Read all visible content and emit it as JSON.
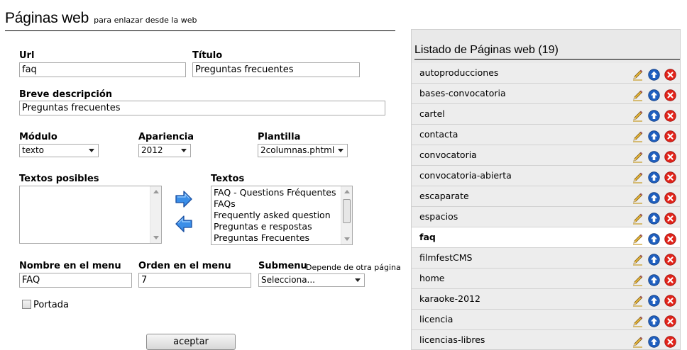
{
  "header": {
    "title": "Páginas web",
    "subtitle": "para enlazar desde la web"
  },
  "form": {
    "url": {
      "label": "Url",
      "value": "faq"
    },
    "titulo": {
      "label": "Título",
      "value": "Preguntas frecuentes"
    },
    "descripcion": {
      "label": "Breve descripción",
      "value": "Preguntas frecuentes"
    },
    "modulo": {
      "label": "Módulo",
      "value": "texto"
    },
    "apariencia": {
      "label": "Apariencia",
      "value": "2012"
    },
    "plantilla": {
      "label": "Plantilla",
      "value": "2columnas.phtml"
    },
    "textos_posibles": {
      "label": "Textos posibles",
      "options": []
    },
    "textos": {
      "label": "Textos",
      "options": [
        "FAQ - Questions Fréquentes",
        "FAQs",
        "Frequently asked question",
        "Preguntas e respostas",
        "Preguntas Frecuentes"
      ]
    },
    "nombre_menu": {
      "label": "Nombre en el menu",
      "value": "FAQ"
    },
    "orden_menu": {
      "label": "Orden en el menu",
      "value": "7"
    },
    "submenu": {
      "label": "Submenu",
      "hint": "Depende de otra página",
      "value": "Selecciona..."
    },
    "portada": {
      "label": "Portada",
      "checked": false
    },
    "submit_label": "aceptar"
  },
  "list": {
    "title": "Listado de Páginas web (19)",
    "active": "faq",
    "items": [
      "autoproducciones",
      "bases-convocatoria",
      "cartel",
      "contacta",
      "convocatoria",
      "convocatoria-abierta",
      "escaparate",
      "espacios",
      "faq",
      "filmfestCMS",
      "home",
      "karaoke-2012",
      "licencia",
      "licencias-libres"
    ],
    "row_icons": [
      "pencil-icon",
      "up-arrow-icon",
      "delete-icon"
    ]
  },
  "colors": {
    "icon_blue": "#1f5fbf",
    "icon_red": "#e2231a",
    "pencil": "#d7a52a",
    "arrow_blue": "#2a7fe0",
    "panel_bg": "#e9e9e9"
  }
}
